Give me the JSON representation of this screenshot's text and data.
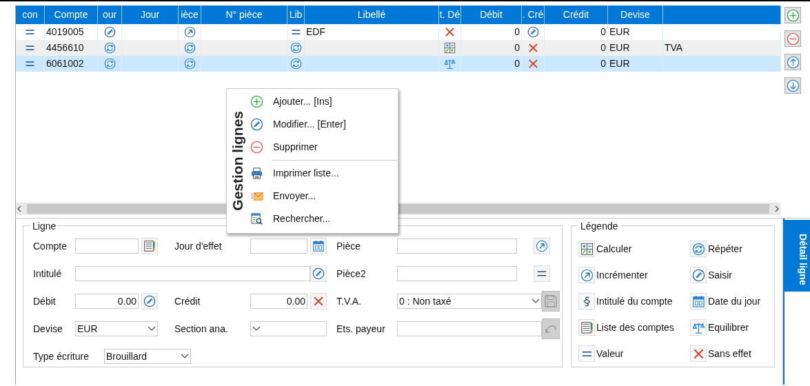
{
  "grid": {
    "columns": [
      {
        "label": "con",
        "kind": "icon"
      },
      {
        "label": "Compte",
        "kind": "text"
      },
      {
        "label": "our",
        "kind": "icon"
      },
      {
        "label": "Jour",
        "kind": "text"
      },
      {
        "label": "ièce",
        "kind": "icon"
      },
      {
        "label": "N° pièce",
        "kind": "text"
      },
      {
        "label": "Lib",
        "kind": "icon"
      },
      {
        "label": "Libellé",
        "kind": "text"
      },
      {
        "label": "t. Dé",
        "kind": "icon"
      },
      {
        "label": "Débit",
        "kind": "amount"
      },
      {
        "label": ". Cré",
        "kind": "icon"
      },
      {
        "label": "Crédit",
        "kind": "amount"
      },
      {
        "label": "Devise",
        "kind": "text"
      },
      {
        "kind": "text"
      }
    ],
    "rows": [
      {
        "selected": false,
        "cells": [
          {
            "kind": "valeur"
          },
          {
            "text": "4019005"
          },
          {
            "kind": "saisir"
          },
          {},
          {
            "kind": "incrementer"
          },
          {},
          {
            "kind": "valeur"
          },
          {
            "text": "EDF"
          },
          {
            "kind": "sans_effet"
          },
          {
            "text": "0"
          },
          {
            "kind": "saisir"
          },
          {
            "text": "0"
          },
          {
            "text": "EUR"
          },
          {}
        ]
      },
      {
        "selected": false,
        "cells": [
          {
            "kind": "valeur"
          },
          {
            "text": "4456610"
          },
          {
            "kind": "repeter"
          },
          {},
          {
            "kind": "repeter"
          },
          {},
          {
            "kind": "repeter"
          },
          {},
          {
            "kind": "calculer"
          },
          {
            "text": "0"
          },
          {
            "kind": "sans_effet"
          },
          {
            "text": "0"
          },
          {
            "text": "EUR"
          },
          {
            "text": "TVA"
          }
        ]
      },
      {
        "selected": true,
        "cells": [
          {
            "kind": "valeur"
          },
          {
            "text": "6061002"
          },
          {
            "kind": "repeter"
          },
          {},
          {
            "kind": "repeter"
          },
          {},
          {
            "kind": "repeter"
          },
          {},
          {
            "kind": "equilibrer"
          },
          {
            "text": "0"
          },
          {
            "kind": "sans_effet"
          },
          {
            "text": "0"
          },
          {
            "text": "EUR"
          },
          {}
        ]
      }
    ]
  },
  "side_buttons": [
    {
      "kind": "add"
    },
    {
      "kind": "remove"
    },
    {
      "kind": "up"
    },
    {
      "kind": "down"
    }
  ],
  "context_menu": {
    "title": "Gestion lignes",
    "groups": [
      [
        {
          "kind": "add",
          "label": "Ajouter... [Ins]"
        },
        {
          "kind": "saisir",
          "label": "Modifier... [Enter]"
        },
        {
          "kind": "remove",
          "label": "Supprimer"
        }
      ],
      [
        {
          "kind": "print",
          "label": "Imprimer liste..."
        },
        {
          "kind": "send",
          "label": "Envoyer..."
        },
        {
          "kind": "search",
          "label": "Rechercher..."
        }
      ]
    ]
  },
  "ligne": {
    "title": "Ligne",
    "rows": [
      {
        "fields": [
          {
            "label": "Compte",
            "kind": "input",
            "button": {
              "kind": "liste"
            }
          },
          {
            "label": "Jour d'effet",
            "kind": "input",
            "button": {
              "kind": "date"
            }
          },
          {
            "label": "Pièce",
            "kind": "input",
            "button": {
              "kind": "incrementer"
            }
          }
        ]
      },
      {
        "fields": [
          {
            "label": "Intitulé",
            "kind": "input",
            "button": {
              "kind": "saisir"
            }
          },
          {
            "label": "Pièce2",
            "kind": "input",
            "button": {
              "kind": "valeur"
            }
          }
        ]
      },
      {
        "fields": [
          {
            "label": "Débit",
            "kind": "input",
            "value": "0.00",
            "button": {
              "kind": "saisir"
            }
          },
          {
            "label": "Crédit",
            "kind": "input",
            "value": "0.00",
            "button": {
              "kind": "sans_effet"
            }
          },
          {
            "label": "T.V.A.",
            "kind": "select",
            "value": "0  : Non taxé"
          }
        ],
        "action": {
          "kind": "save",
          "disabled": true
        }
      },
      {
        "fields": [
          {
            "label": "Devise",
            "kind": "select",
            "value": "EUR"
          },
          {
            "label": "Section ana.",
            "kind": "select"
          },
          {
            "label": "Ets. payeur",
            "kind": "input"
          }
        ],
        "action": {
          "kind": "undo",
          "disabled": true
        }
      },
      {
        "fields": [
          {
            "label": "Type écriture",
            "kind": "select",
            "value": "Brouillard"
          }
        ]
      }
    ]
  },
  "legende": {
    "title": "Légende",
    "items": [
      {
        "kind": "calculer",
        "label": "Calculer"
      },
      {
        "kind": "repeter",
        "label": "Répéter"
      },
      {
        "kind": "incrementer",
        "label": "Incrémenter"
      },
      {
        "kind": "saisir",
        "label": "Saisir"
      },
      {
        "kind": "intitule",
        "label": "Intitulé du compte"
      },
      {
        "kind": "date",
        "label": "Date du jour"
      },
      {
        "kind": "liste",
        "label": "Liste des comptes"
      },
      {
        "kind": "equilibrer",
        "label": "Equilibrer"
      },
      {
        "kind": "valeur",
        "label": "Valeur"
      },
      {
        "kind": "sans_effet",
        "label": "Sans effet"
      }
    ]
  },
  "side_tab": {
    "label": "Détail ligne",
    "selected": true
  }
}
